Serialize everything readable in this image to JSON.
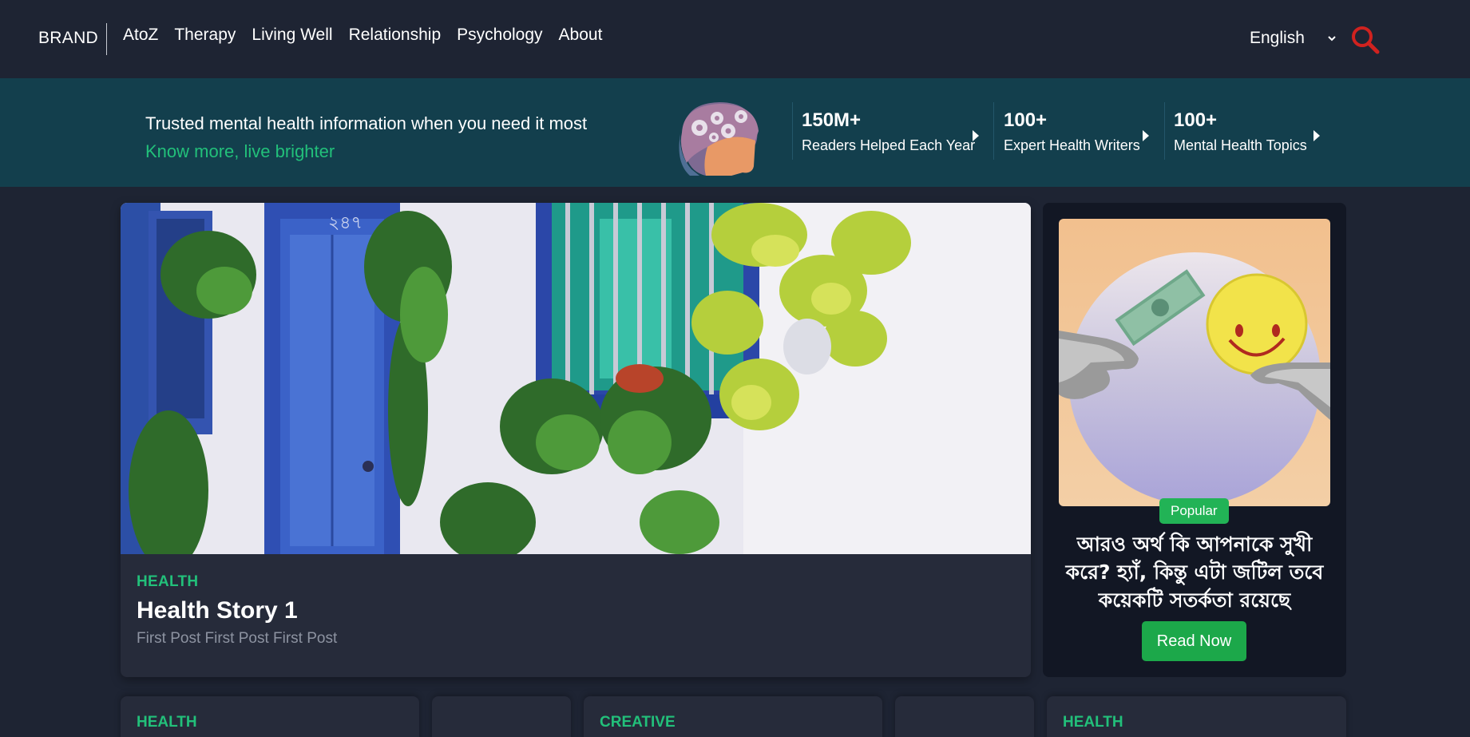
{
  "nav": {
    "brand": "BRAND",
    "links": [
      "AtoZ",
      "Therapy",
      "Living Well",
      "Relationship",
      "Psychology",
      "About"
    ],
    "language": "English"
  },
  "banner": {
    "title": "Trusted mental health information when you need it most",
    "subtitle": "Know more, live brighter",
    "stats": [
      {
        "number": "150M+",
        "label": "Readers Helped Each Year"
      },
      {
        "number": "100+",
        "label": "Expert Health Writers"
      },
      {
        "number": "100+",
        "label": "Mental Health Topics"
      }
    ]
  },
  "main_post": {
    "category": "HEALTH",
    "title": "Health Story 1",
    "excerpt": "First Post First Post First Post",
    "door_number": "২৪৭"
  },
  "side_post": {
    "badge": "Popular",
    "title": "আরও অর্থ কি আপনাকে সুখী করে? হ্যাঁ, কিন্তু এটা জটিল তবে কয়েকটি সতর্কতা রয়েছে",
    "button": "Read Now"
  },
  "bottom_cards": [
    {
      "category": "HEALTH"
    },
    {
      "category": ""
    },
    {
      "category": "CREATIVE"
    },
    {
      "category": ""
    },
    {
      "category": "HEALTH"
    }
  ],
  "colors": {
    "background": "#1e2433",
    "banner": "#133f4d",
    "accent_green": "#22c07a",
    "search_red": "#d0221f"
  }
}
